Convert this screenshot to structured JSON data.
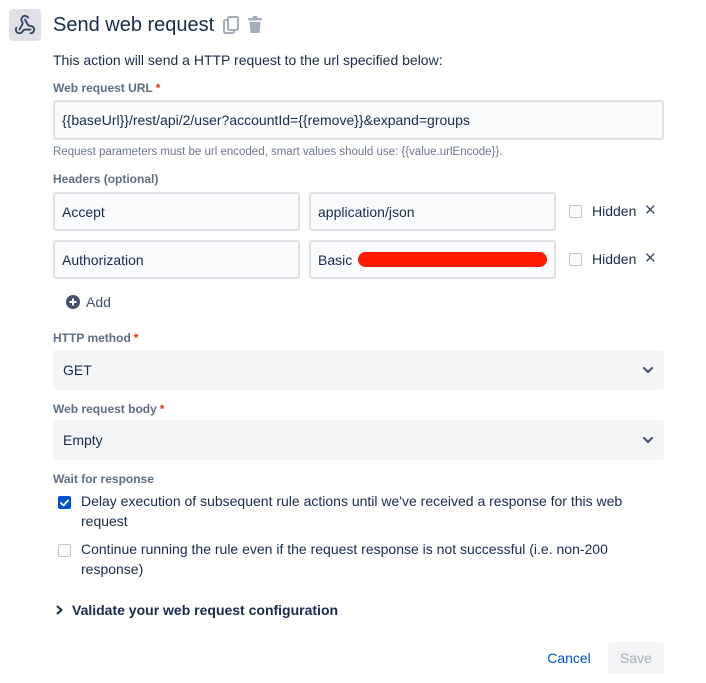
{
  "header": {
    "title": "Send web request",
    "description": "This action will send a HTTP request to the url specified below:",
    "app_icon": "webhook-icon",
    "copy_icon": "copy-icon",
    "delete_icon": "trash-icon"
  },
  "url": {
    "label": "Web request URL",
    "required_mark": "*",
    "value": "{{baseUrl}}/rest/api/2/user?accountId={{remove}}&expand=groups",
    "helper": "Request parameters must be url encoded, smart values should use: {{value.urlEncode}}."
  },
  "headers": {
    "label": "Headers (optional)",
    "rows": [
      {
        "key": "Accept",
        "value": "application/json",
        "hidden_label": "Hidden",
        "hidden_checked": false
      },
      {
        "key": "Authorization",
        "value": "Basic",
        "hidden_label": "Hidden",
        "hidden_checked": false
      }
    ],
    "add_label": "Add"
  },
  "method": {
    "label": "HTTP method",
    "required_mark": "*",
    "selected": "GET"
  },
  "body": {
    "label": "Web request body",
    "required_mark": "*",
    "selected": "Empty"
  },
  "wait": {
    "label": "Wait for response",
    "options": [
      {
        "text": "Delay execution of subsequent rule actions until we've received a response for this web request",
        "checked": true
      },
      {
        "text": "Continue running the rule even if the request response is not successful (i.e. non-200 response)",
        "checked": false
      }
    ]
  },
  "validate": {
    "label": "Validate your web request configuration"
  },
  "footer": {
    "cancel_label": "Cancel",
    "save_label": "Save"
  },
  "colors": {
    "primary": "#0052cc",
    "link": "#0052cc",
    "required": "#de350b",
    "redaction": "#ff1a00"
  }
}
